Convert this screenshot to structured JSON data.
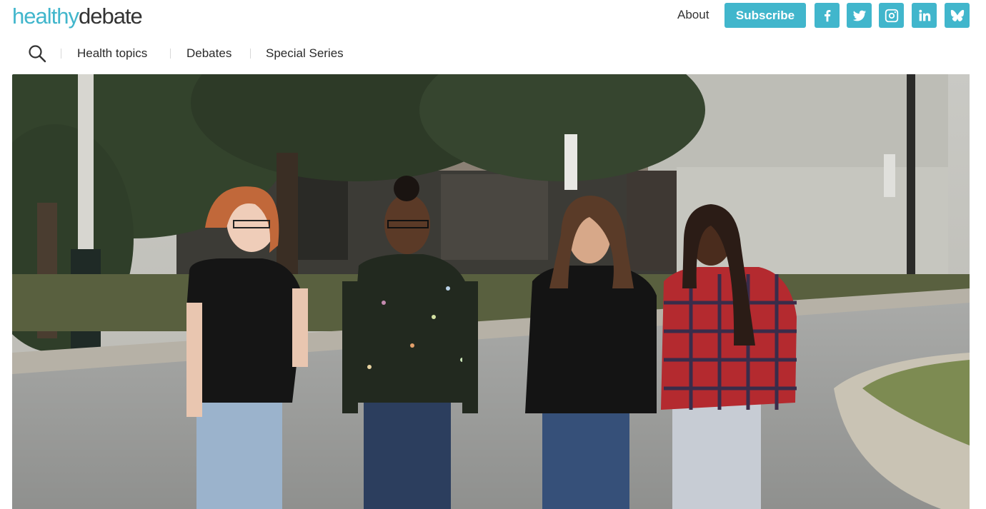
{
  "header": {
    "logo": {
      "part1": "healthy",
      "part2": "debate"
    },
    "about_label": "About",
    "subscribe_label": "Subscribe",
    "social_icons": [
      "facebook-icon",
      "twitter-icon",
      "instagram-icon",
      "linkedin-icon",
      "bluesky-icon"
    ]
  },
  "nav": {
    "search_icon": "search-icon",
    "items": [
      {
        "label": "Health topics"
      },
      {
        "label": "Debates"
      },
      {
        "label": "Special Series"
      }
    ]
  },
  "hero": {
    "image_description_icon": "photo-four-women-street"
  },
  "colors": {
    "brand": "#41b6cc",
    "text_dark": "#333333"
  }
}
